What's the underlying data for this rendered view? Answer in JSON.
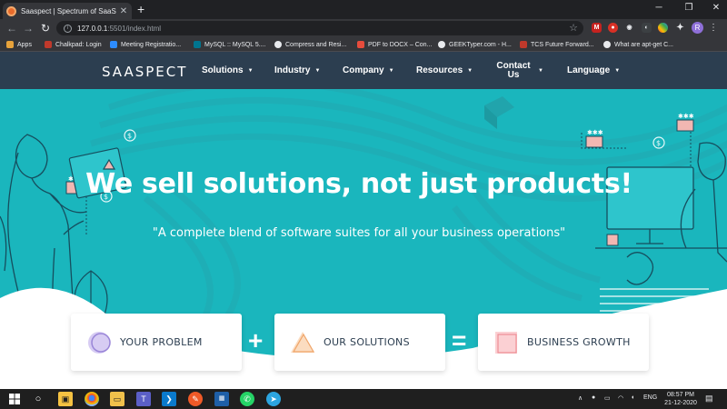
{
  "browser": {
    "tab_title": "Saaspect | Spectrum of SaaS",
    "new_tab_symbol": "+",
    "url_host": "127.0.0.1",
    "url_path": ":5501/index.html",
    "profile_initial": "R",
    "bookmarks": [
      {
        "label": "Apps",
        "color": "#e8a33b"
      },
      {
        "label": "Chalkpad: Login",
        "color": "#c0392b"
      },
      {
        "label": "Meeting Registratio...",
        "color": "#2d8cff"
      },
      {
        "label": "MySQL :: MySQL 5....",
        "color": "#00758f"
      },
      {
        "label": "Compress and Resi...",
        "color": "#e8eaed"
      },
      {
        "label": "PDF to DOCX – Con...",
        "color": "#e74c3c"
      },
      {
        "label": "GEEKTyper.com - H...",
        "color": "#e8eaed"
      },
      {
        "label": "TCS Future Forward...",
        "color": "#c0392b"
      },
      {
        "label": "What are apt-get C...",
        "color": "#e8eaed"
      }
    ]
  },
  "site": {
    "logo": "SAASPECT",
    "nav": [
      {
        "label": "Solutions"
      },
      {
        "label": "Industry"
      },
      {
        "label": "Company"
      },
      {
        "label": "Resources"
      },
      {
        "label": "Contact Us"
      },
      {
        "label": "Language"
      }
    ],
    "headline": "We sell solutions, not just products!",
    "tagline": "\"A complete blend of software suites for all your business operations\"",
    "cards": [
      {
        "label": "YOUR PROBLEM",
        "icon": "circle-icon",
        "color": "#b9a8e8"
      },
      {
        "label": "OUR SOLUTIONS",
        "icon": "triangle-icon",
        "color": "#f7c9a0"
      },
      {
        "label": "BUSINESS GROWTH",
        "icon": "square-icon",
        "color": "#f4a9ae"
      }
    ],
    "operators": [
      "+",
      "="
    ],
    "colors": {
      "nav_bg": "#2c3e50",
      "hero_bg": "#1ab6bd"
    }
  },
  "taskbar": {
    "language": "ENG",
    "time": "08:57 PM",
    "date": "21-12-2020"
  }
}
